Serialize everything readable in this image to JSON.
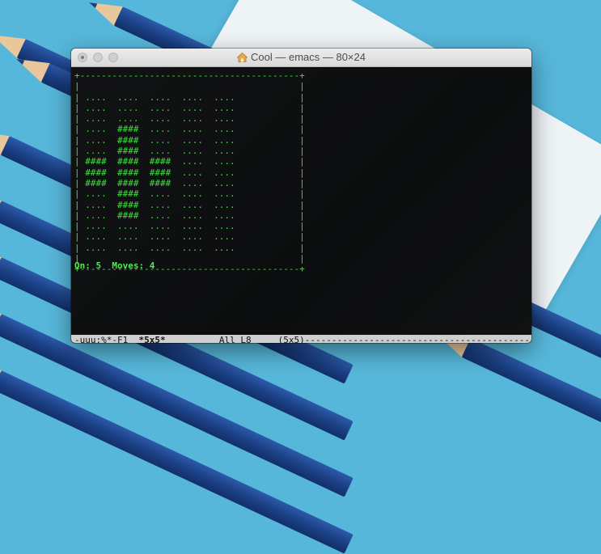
{
  "window": {
    "title": "Cool — emacs — 80×24"
  },
  "game": {
    "board_lines": [
      "+-----------------------------------------+",
      "|                                         |",
      "| ....  ....  ....  ....  ....            |",
      "| ....  ....  ....  ....  ....            |",
      "| ....  ....  ....  ....  ....            |",
      "| ....  ####  ....  ....  ....            |",
      "| ....  ####  ....  ....  ....            |",
      "| ....  ####  ....  ....  ....            |",
      "| ####  ####  ####  ....  ....            |",
      "| ####  ####  ####  ....  ....            |",
      "| ####  ####  ####  ....  ....            |",
      "| ....  ####  ....  ....  ....            |",
      "| ....  ####  ....  ....  ....            |",
      "| ....  ####  ....  ....  ....            |",
      "| ....  ....  ....  ....  ....            |",
      "| ....  ....  ....  ....  ....            |",
      "| ....  ....  ....  ....  ....            |",
      "|                                         |",
      "+-----------------------------------------+"
    ],
    "status_line": "On: 5  Moves: 4"
  },
  "modeline": {
    "prefix": "-uuu:%*-F1  ",
    "buffer_name": "*5x5*",
    "position": "          All L8     (5x5)",
    "fill": "------------------------------------------------------------------"
  }
}
